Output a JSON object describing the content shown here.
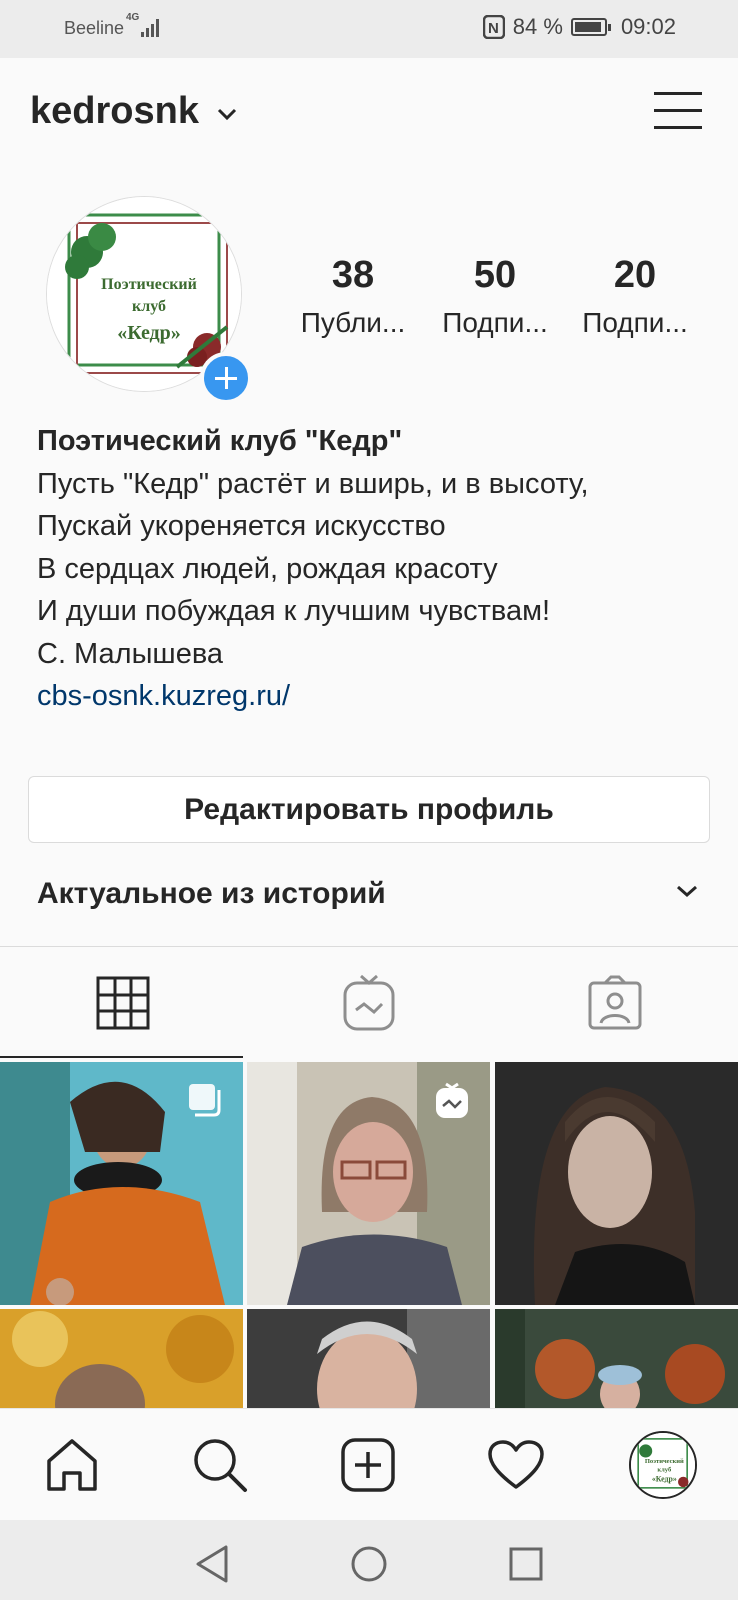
{
  "status_bar": {
    "carrier": "Beeline",
    "network": "4G",
    "nfc": "N",
    "battery": "84 %",
    "time": "09:02"
  },
  "header": {
    "username": "kedrosnk"
  },
  "avatar": {
    "line1": "Поэтический",
    "line2": "клуб",
    "line3": "«Кедр»"
  },
  "stats": [
    {
      "value": "38",
      "label": "Публи..."
    },
    {
      "value": "50",
      "label": "Подпи..."
    },
    {
      "value": "20",
      "label": "Подпи..."
    }
  ],
  "bio": {
    "name": "Поэтический клуб \"Кедр\"",
    "lines": [
      "Пусть \"Кедр\" растёт и вширь, и в высоту,",
      "Пускай укореняется искусство",
      "В сердцах людей, рождая красоту",
      "И души побуждая к лучшим чувствам!",
      "С. Малышева"
    ],
    "link": "cbs-osnk.kuzreg.ru/"
  },
  "edit_profile_label": "Редактировать профиль",
  "highlights_label": "Актуальное из историй",
  "tabs": [
    {
      "icon": "grid-icon",
      "active": true
    },
    {
      "icon": "igtv-icon",
      "active": false
    },
    {
      "icon": "tagged-icon",
      "active": false
    }
  ],
  "bottom_nav": [
    "home-icon",
    "search-icon",
    "new-post-icon",
    "activity-heart-icon",
    "profile-avatar"
  ],
  "system_nav": [
    "back-icon",
    "home-circle-icon",
    "recents-icon"
  ],
  "colors": {
    "accent_blue": "#3897f0",
    "link": "#00376b",
    "text": "#262626",
    "background": "#fafafa"
  }
}
